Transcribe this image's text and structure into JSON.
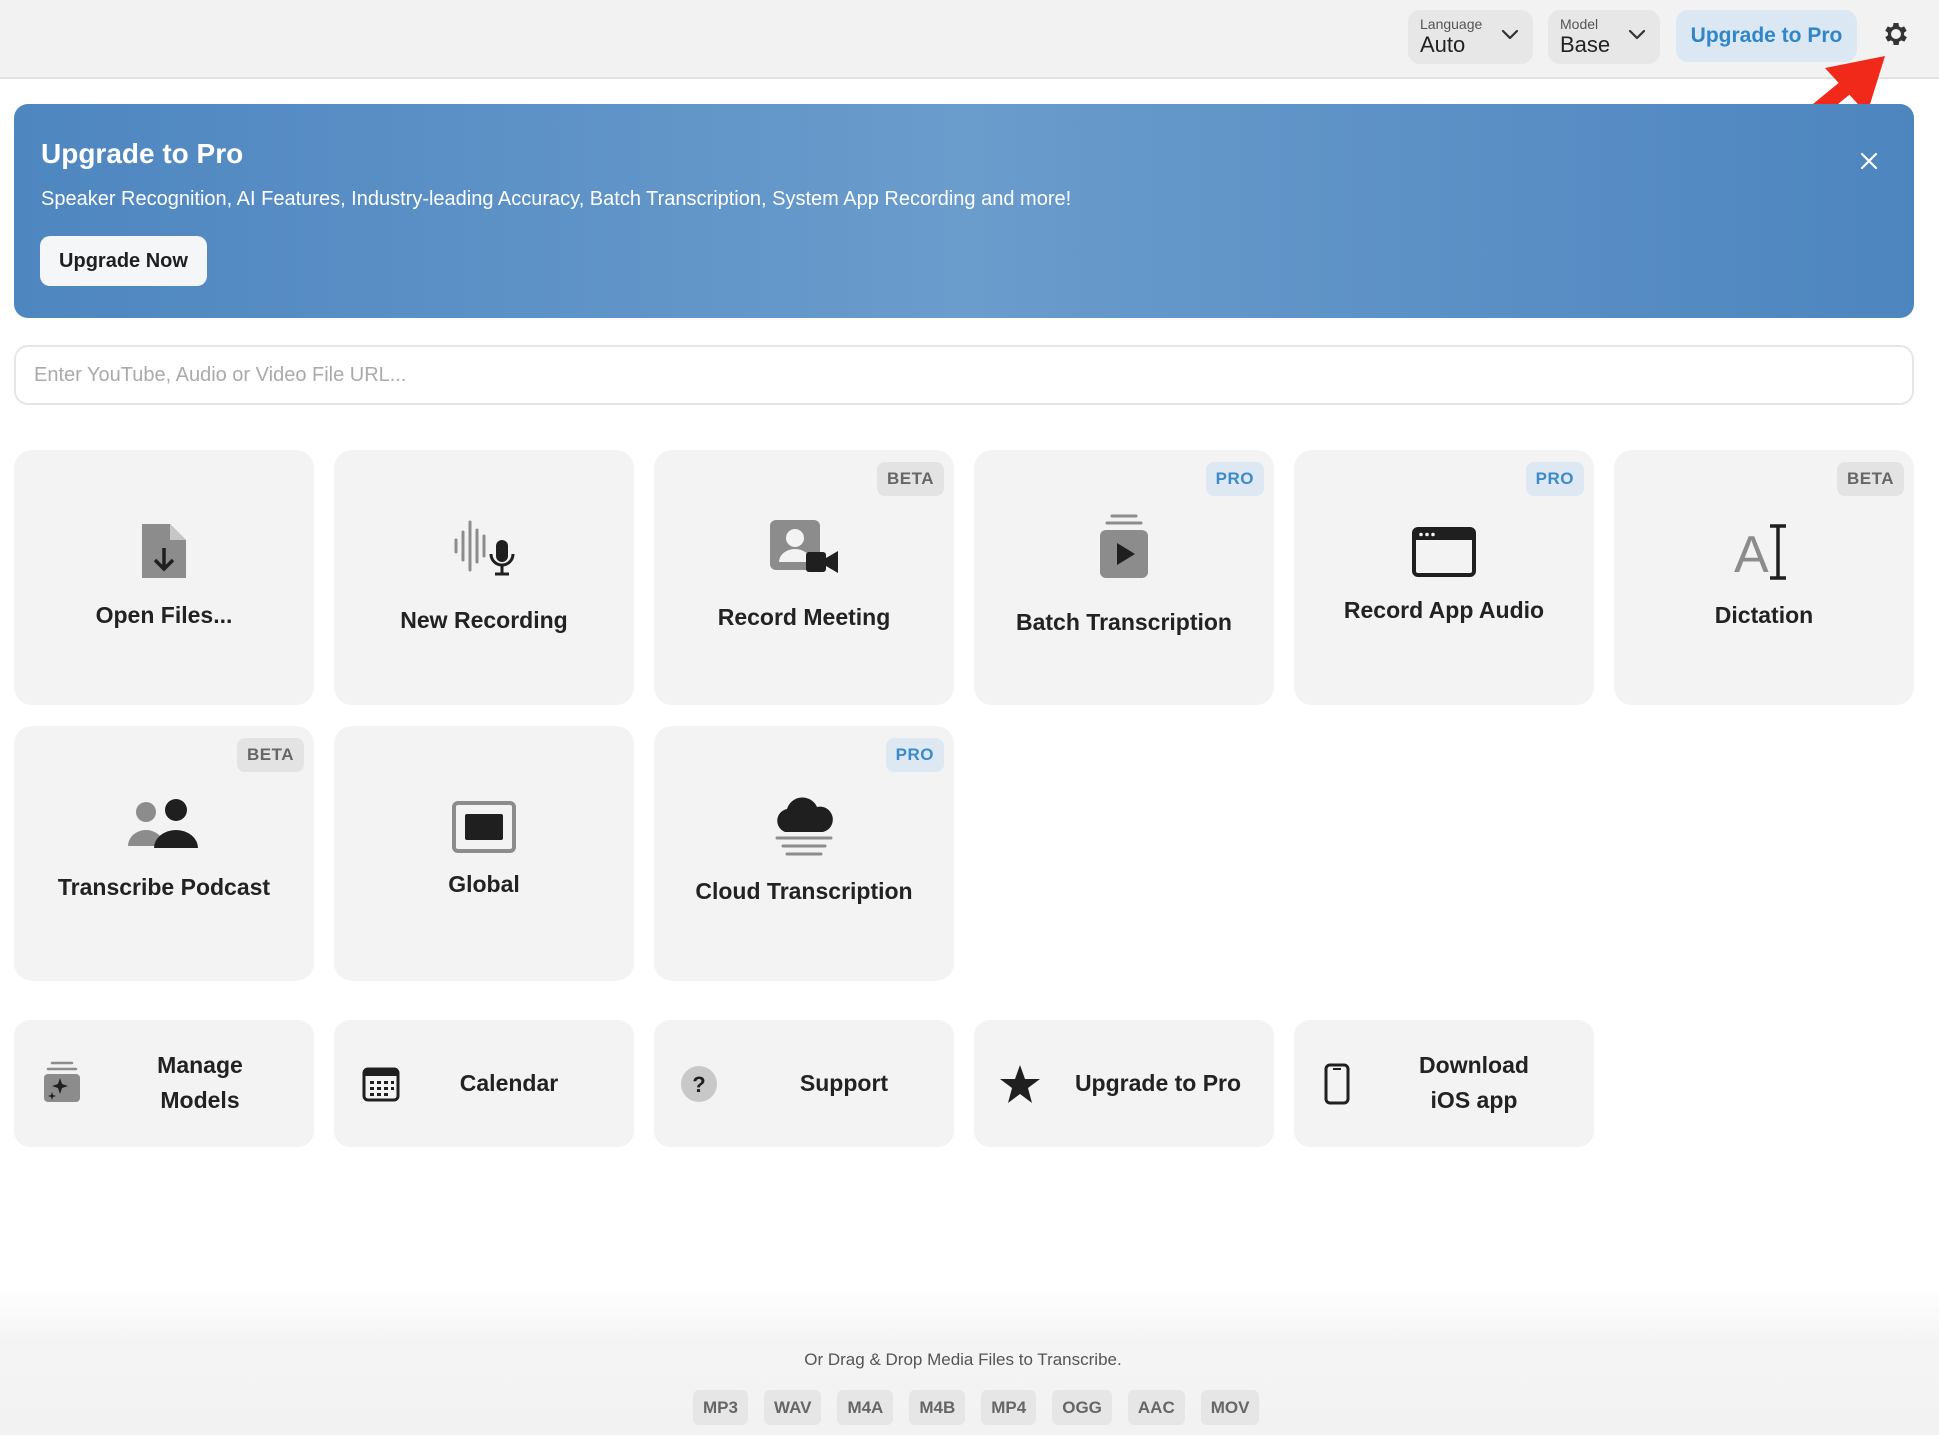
{
  "topbar": {
    "language": {
      "label": "Language",
      "value": "Auto"
    },
    "model": {
      "label": "Model",
      "value": "Base"
    },
    "upgrade_label": "Upgrade to Pro"
  },
  "banner": {
    "title": "Upgrade to Pro",
    "subtitle": "Speaker Recognition, AI Features, Industry-leading Accuracy, Batch Transcription, System App Recording and more!",
    "button_label": "Upgrade Now",
    "gradient_colors": [
      "#4e86c0",
      "#6a9ccc",
      "#4d85bf"
    ]
  },
  "url_input": {
    "placeholder": "Enter YouTube, Audio or Video File URL...",
    "value": ""
  },
  "tiles": [
    {
      "label": "Open Files...",
      "icon": "file-download-icon",
      "badge": ""
    },
    {
      "label": "New Recording",
      "icon": "waveform-mic-icon",
      "badge": ""
    },
    {
      "label": "Record Meeting",
      "icon": "person-video-icon",
      "badge": "BETA"
    },
    {
      "label": "Batch Transcription",
      "icon": "stacked-play-icon",
      "badge": "PRO"
    },
    {
      "label": "Record App Audio",
      "icon": "app-window-icon",
      "badge": "PRO"
    },
    {
      "label": "Dictation",
      "icon": "text-cursor-icon",
      "badge": "BETA"
    },
    {
      "label": "Transcribe Podcast",
      "icon": "people-icon",
      "badge": "BETA"
    },
    {
      "label": "Global",
      "icon": "screen-icon",
      "badge": ""
    },
    {
      "label": "Cloud Transcription",
      "icon": "cloud-icon",
      "badge": "PRO"
    }
  ],
  "bottom_buttons": [
    {
      "label_line1": "Manage",
      "label_line2": "Models",
      "icon": "sparkle-stack-icon"
    },
    {
      "label": "Calendar",
      "icon": "calendar-icon"
    },
    {
      "label": "Support",
      "icon": "question-icon"
    },
    {
      "label": "Upgrade to Pro",
      "icon": "star-icon"
    },
    {
      "label_line1": "Download",
      "label_line2": "iOS app",
      "icon": "phone-icon"
    }
  ],
  "dropzone": {
    "text": "Or Drag & Drop Media Files to Transcribe.",
    "formats": [
      "MP3",
      "WAV",
      "M4A",
      "M4B",
      "MP4",
      "OGG",
      "AAC",
      "MOV"
    ]
  },
  "colors": {
    "accent": "#2f86c9",
    "annotation_arrow": "#f0291a",
    "tile_background": "#f3f3f3"
  }
}
